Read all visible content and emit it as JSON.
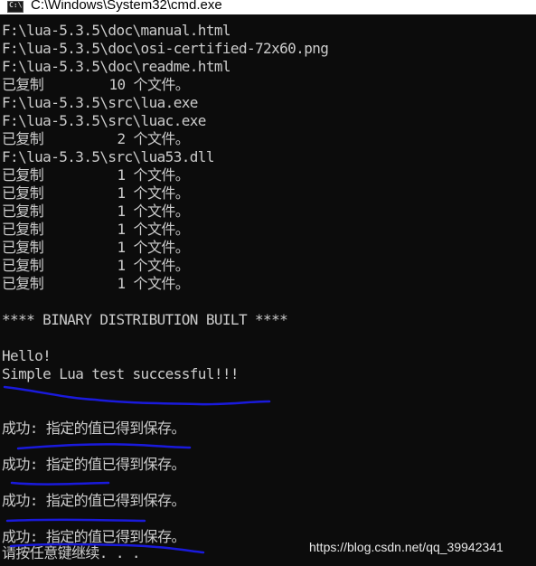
{
  "window": {
    "title": "C:\\Windows\\System32\\cmd.exe",
    "icon": "cmd-icon",
    "icon_text": "C:\\"
  },
  "console": {
    "lines": [
      "F:\\lua-5.3.5\\doc\\manual.html",
      "F:\\lua-5.3.5\\doc\\osi-certified-72x60.png",
      "F:\\lua-5.3.5\\doc\\readme.html",
      "已复制        10 个文件。",
      "F:\\lua-5.3.5\\src\\lua.exe",
      "F:\\lua-5.3.5\\src\\luac.exe",
      "已复制         2 个文件。",
      "F:\\lua-5.3.5\\src\\lua53.dll",
      "已复制         1 个文件。",
      "已复制         1 个文件。",
      "已复制         1 个文件。",
      "已复制         1 个文件。",
      "已复制         1 个文件。",
      "已复制         1 个文件。",
      "已复制         1 个文件。",
      "",
      "**** BINARY DISTRIBUTION BUILT ****",
      "",
      "Hello!",
      "Simple Lua test successful!!!",
      "",
      "",
      "成功: 指定的值已得到保存。",
      "",
      "成功: 指定的值已得到保存。",
      "",
      "成功: 指定的值已得到保存。",
      "",
      "成功: 指定的值已得到保存。",
      "请按任意键继续. . ."
    ]
  },
  "watermark": "https://blog.csdn.net/qq_39942341",
  "colors": {
    "console_bg": "#0c0c0c",
    "console_text": "#cccccc",
    "annotation": "#1a1adc"
  }
}
